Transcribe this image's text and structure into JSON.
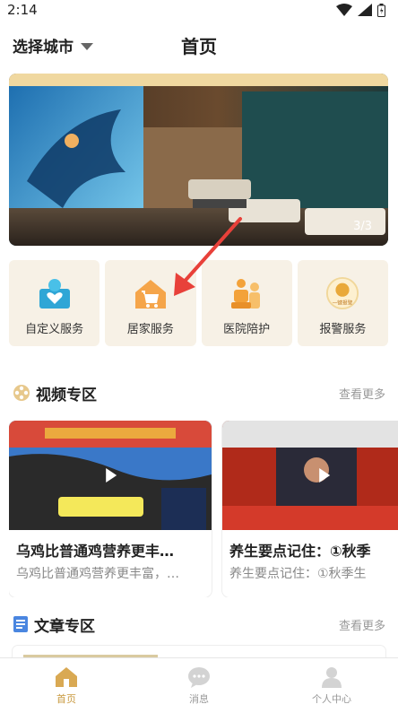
{
  "status_bar": {
    "time": "2:14"
  },
  "header": {
    "city_selector": "选择城市",
    "title": "首页"
  },
  "banner": {
    "counter": "3/3"
  },
  "services": [
    {
      "label": "自定义服务",
      "icon": "heart-hand-icon"
    },
    {
      "label": "居家服务",
      "icon": "house-cart-icon"
    },
    {
      "label": "医院陪护",
      "icon": "caregiver-icon"
    },
    {
      "label": "报警服务",
      "icon": "alarm-button-icon",
      "icon_text": "一键报警"
    }
  ],
  "video_section": {
    "title": "视频专区",
    "more": "查看更多",
    "videos": [
      {
        "title": "乌鸡比普通鸡营养更丰…",
        "desc": "乌鸡比普通鸡营养更丰富，…"
      },
      {
        "title": "养生要点记住：①秋季",
        "desc": "养生要点记住：①秋季生"
      }
    ]
  },
  "article_section": {
    "title": "文章专区",
    "more": "查看更多"
  },
  "nav": {
    "items": [
      {
        "label": "首页",
        "active": true
      },
      {
        "label": "消息",
        "active": false
      },
      {
        "label": "个人中心",
        "active": false
      }
    ]
  },
  "colors": {
    "accent": "#c99a40",
    "service_bg": "#f7f1e6",
    "annotation": "#e8413a"
  }
}
